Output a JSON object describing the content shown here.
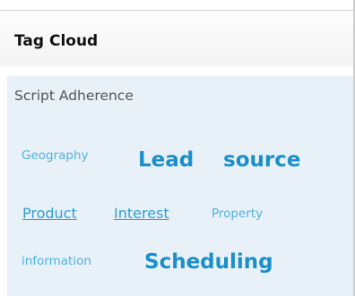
{
  "widget": {
    "title": "Tag Cloud",
    "subtitle": "Script Adherence",
    "tags": [
      {
        "id": "geography",
        "label": "Geography"
      },
      {
        "id": "lead",
        "label": "Lead"
      },
      {
        "id": "source",
        "label": "source"
      },
      {
        "id": "product",
        "label": "Product"
      },
      {
        "id": "interest",
        "label": "Interest"
      },
      {
        "id": "property",
        "label": "Property"
      },
      {
        "id": "information",
        "label": "information"
      },
      {
        "id": "scheduling",
        "label": "Scheduling"
      }
    ]
  },
  "colors": {
    "tag_accent": "#1a8fc9",
    "panel_background": "#e9f1f8"
  }
}
